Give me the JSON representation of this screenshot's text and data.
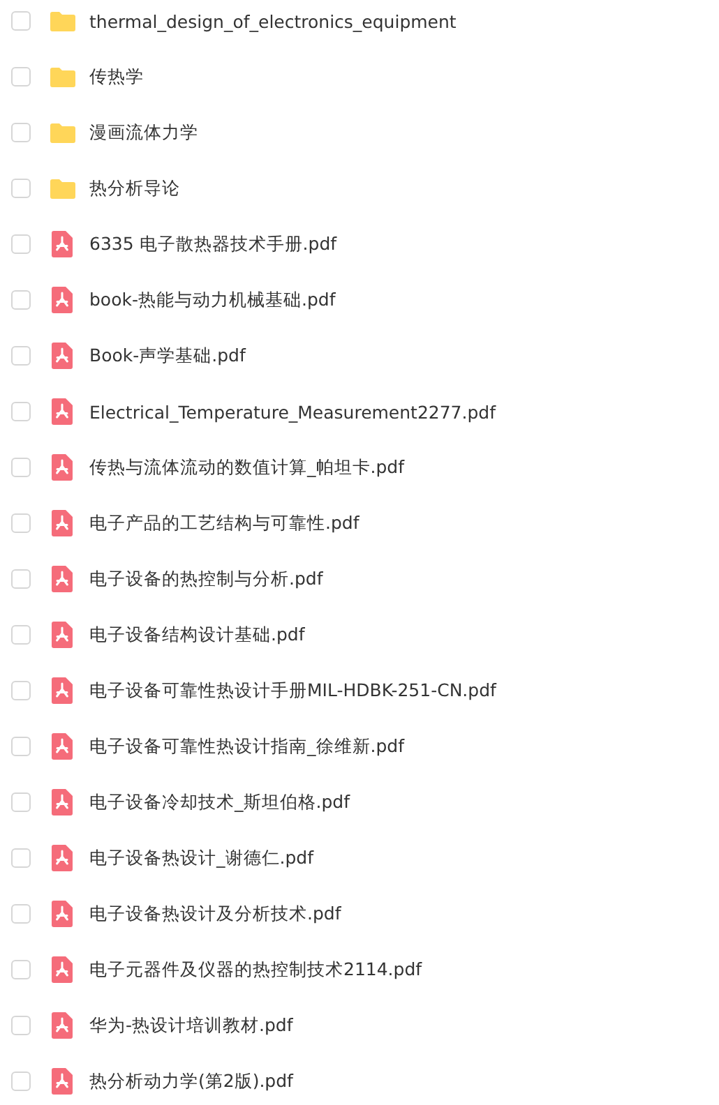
{
  "files": [
    {
      "kind": "folder",
      "name": "thermal_design_of_electronics_equipment",
      "checked": false
    },
    {
      "kind": "folder",
      "name": "传热学",
      "checked": false
    },
    {
      "kind": "folder",
      "name": "漫画流体力学",
      "checked": false
    },
    {
      "kind": "folder",
      "name": "热分析导论",
      "checked": false
    },
    {
      "kind": "pdf",
      "name": "6335 电子散热器技术手册.pdf",
      "checked": false
    },
    {
      "kind": "pdf",
      "name": "book-热能与动力机械基础.pdf",
      "checked": false
    },
    {
      "kind": "pdf",
      "name": "Book-声学基础.pdf",
      "checked": false
    },
    {
      "kind": "pdf",
      "name": "Electrical_Temperature_Measurement2277.pdf",
      "checked": false
    },
    {
      "kind": "pdf",
      "name": "传热与流体流动的数值计算_帕坦卡.pdf",
      "checked": false
    },
    {
      "kind": "pdf",
      "name": "电子产品的工艺结构与可靠性.pdf",
      "checked": false
    },
    {
      "kind": "pdf",
      "name": "电子设备的热控制与分析.pdf",
      "checked": false
    },
    {
      "kind": "pdf",
      "name": "电子设备结构设计基础.pdf",
      "checked": false
    },
    {
      "kind": "pdf",
      "name": "电子设备可靠性热设计手册MIL-HDBK-251-CN.pdf",
      "checked": false
    },
    {
      "kind": "pdf",
      "name": "电子设备可靠性热设计指南_徐维新.pdf",
      "checked": false
    },
    {
      "kind": "pdf",
      "name": "电子设备冷却技术_斯坦伯格.pdf",
      "checked": false
    },
    {
      "kind": "pdf",
      "name": "电子设备热设计_谢德仁.pdf",
      "checked": false
    },
    {
      "kind": "pdf",
      "name": "电子设备热设计及分析技术.pdf",
      "checked": false
    },
    {
      "kind": "pdf",
      "name": "电子元器件及仪器的热控制技术2114.pdf",
      "checked": false
    },
    {
      "kind": "pdf",
      "name": "华为-热设计培训教材.pdf",
      "checked": false
    },
    {
      "kind": "pdf",
      "name": "热分析动力学(第2版).pdf",
      "checked": false
    }
  ]
}
